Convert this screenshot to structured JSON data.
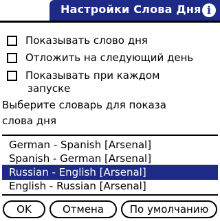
{
  "title": "Настройки Слова Дня",
  "info_icon": "info-icon",
  "options": [
    {
      "label": "Показывать слово дня",
      "checked": false
    },
    {
      "label": "Отложить на следующий день",
      "checked": false
    },
    {
      "label": "Показывать при каждом",
      "label_cont": "запуске",
      "checked": false
    }
  ],
  "prompt_line1": "Выберите словарь для показа",
  "prompt_line2": "слова дня",
  "dictionaries": [
    {
      "label": "German - Spanish [Arsenal]",
      "selected": false
    },
    {
      "label": "Spanish - German [Arsenal]",
      "selected": false
    },
    {
      "label": "Russian - English [Arsenal]",
      "selected": true
    },
    {
      "label": "English - Russian [Arsenal]",
      "selected": false
    }
  ],
  "buttons": {
    "ok": "OK",
    "cancel": "Отмена",
    "default": "По умолчанию"
  },
  "colors": {
    "title_bg": "#1e2a87",
    "selection_bg": "#1e2a87"
  }
}
